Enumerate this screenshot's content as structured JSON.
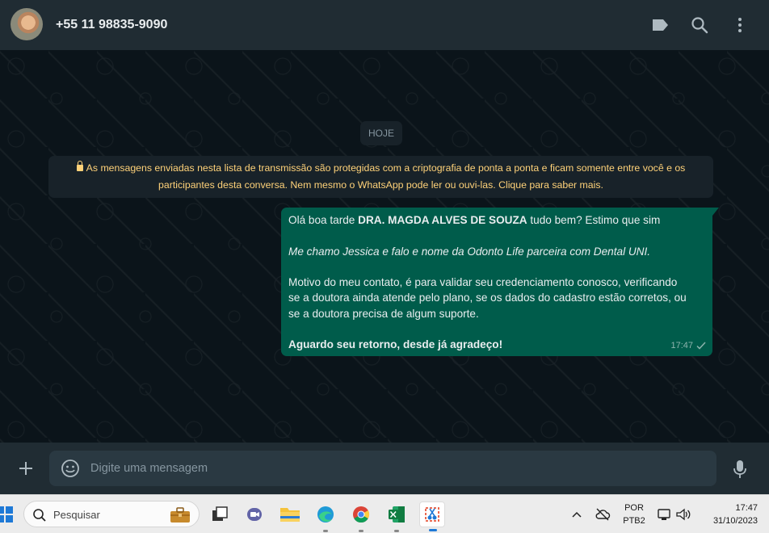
{
  "header": {
    "contact_name": "+55 11 98835-9090"
  },
  "chat": {
    "date_chip": "HOJE",
    "e2e_notice_line1": "As mensagens enviadas nesta lista de transmissão são protegidas com a criptografia de ponta a ponta e ficam somente entre você e os",
    "e2e_notice_line2": "participantes desta conversa. Nem mesmo o WhatsApp pode ler ou ouvi-las. Clique para saber mais.",
    "message": {
      "line1_prefix": "Olá boa tarde ",
      "line1_bold": "DRA. MAGDA ALVES DE SOUZA",
      "line1_suffix": " tudo bem? Estimo que sim",
      "line2_italic": "Me chamo Jessica e falo e nome da Odonto Life parceira com Dental UNI.",
      "line3a": "Motivo do meu contato, é para validar seu credenciamento conosco, verificando",
      "line3b": "se a doutora ainda atende pelo plano, se os dados do cadastro estão corretos, ou",
      "line3c": "se a doutora precisa de algum suporte.",
      "line4_bold": "Aguardo seu retorno, desde já agradeço!",
      "time": "17:47"
    }
  },
  "composer": {
    "placeholder": "Digite uma mensagem"
  },
  "taskbar": {
    "search_placeholder": "Pesquisar",
    "lang_line1": "POR",
    "lang_line2": "PTB2",
    "time": "17:47",
    "date": "31/10/2023",
    "apps": [
      "task-view-icon",
      "teams-icon",
      "file-explorer-icon",
      "edge-icon",
      "chrome-icon",
      "excel-icon",
      "snipping-tool-icon"
    ]
  },
  "colors": {
    "header_bg": "#202c33",
    "chat_bg": "#0b141a",
    "outgoing_bubble": "#005c4b",
    "notice_text": "#ffd279",
    "taskbar_bg": "#ececec"
  }
}
